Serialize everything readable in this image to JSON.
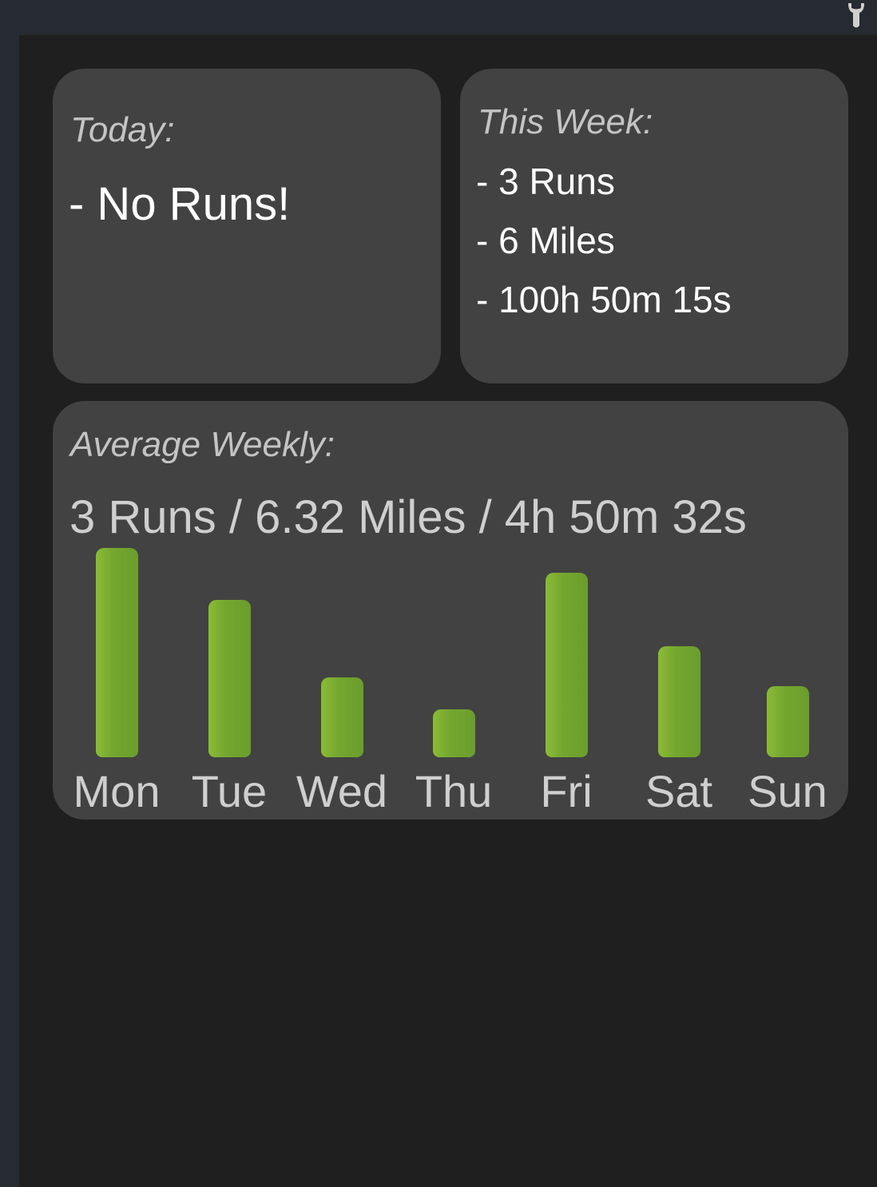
{
  "icons": {
    "top_right": "wrench-icon"
  },
  "colors": {
    "bar": "#74a72f",
    "card": "#424242",
    "background": "#1f1f1f"
  },
  "today": {
    "label": "Today:",
    "line": "- No Runs!"
  },
  "this_week": {
    "label": "This Week:",
    "lines": [
      "- 3 Runs",
      "- 6 Miles",
      "- 100h 50m 15s"
    ]
  },
  "average_weekly": {
    "label": "Average Weekly:",
    "summary": "3 Runs  /  6.32 Miles  /  4h 50m 32s"
  },
  "chart_data": {
    "type": "bar",
    "categories": [
      "Mon",
      "Tue",
      "Wed",
      "Thu",
      "Fri",
      "Sat",
      "Sun"
    ],
    "values": [
      1.0,
      0.75,
      0.38,
      0.23,
      0.88,
      0.53,
      0.34
    ],
    "title": "",
    "xlabel": "",
    "ylabel": "",
    "ylim": [
      0,
      1
    ],
    "grid": false,
    "legend": "none"
  }
}
